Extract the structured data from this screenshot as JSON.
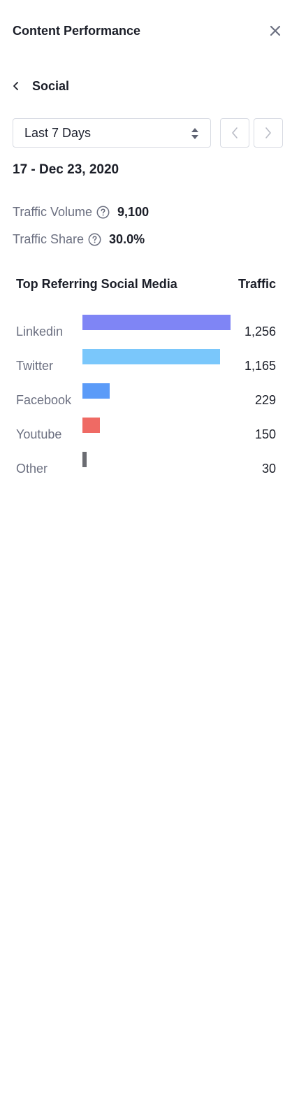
{
  "header": {
    "title": "Content Performance"
  },
  "nav": {
    "back_label": "Social"
  },
  "range": {
    "selected": "Last 7 Days"
  },
  "date_range": "17 - Dec 23, 2020",
  "metrics": {
    "traffic_volume": {
      "label": "Traffic Volume",
      "value": "9,100"
    },
    "traffic_share": {
      "label": "Traffic Share",
      "value": "30.0%"
    }
  },
  "table": {
    "title": "Top Referring Social Media",
    "value_header": "Traffic",
    "rows": [
      {
        "label": "Linkedin",
        "value": "1,256",
        "amount": 1256,
        "color": "#7f85f5"
      },
      {
        "label": "Twitter",
        "value": "1,165",
        "amount": 1165,
        "color": "#7ac7fb"
      },
      {
        "label": "Facebook",
        "value": "229",
        "amount": 229,
        "color": "#5b9bf8"
      },
      {
        "label": "Youtube",
        "value": "150",
        "amount": 150,
        "color": "#ef6a64"
      },
      {
        "label": "Other",
        "value": "30",
        "amount": 30,
        "color": "#6b6c72"
      }
    ]
  },
  "icons": {
    "close": "close-icon",
    "back": "chevron-left-icon",
    "sort": "sort-icon",
    "prev": "chevron-left-icon",
    "next": "chevron-right-icon",
    "help": "question-circle-icon"
  }
}
